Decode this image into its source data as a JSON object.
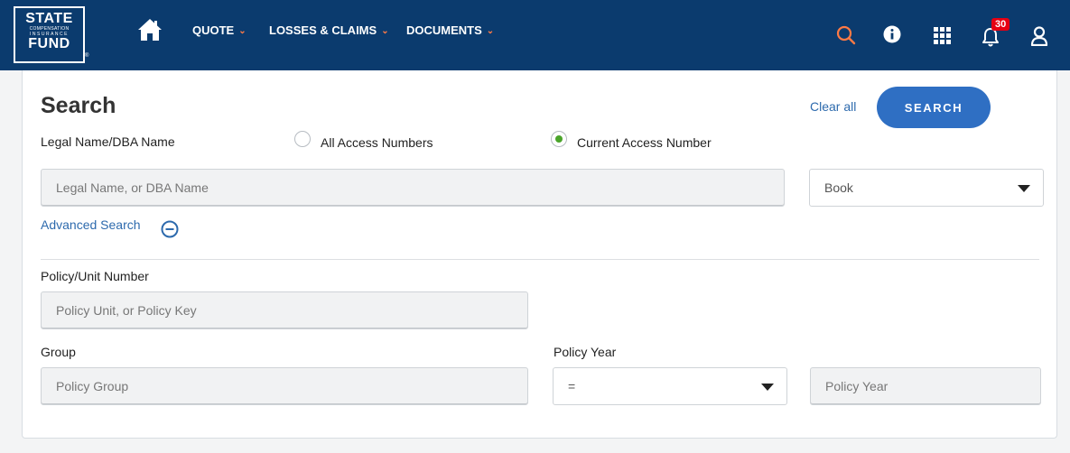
{
  "brand": {
    "line1": "STATE",
    "line2": "COMPENSATION",
    "line3": "INSURANCE",
    "line4": "FUND",
    "registered": "®"
  },
  "nav": {
    "items": [
      {
        "label": "QUOTE",
        "chevron": "⌄"
      },
      {
        "label": "LOSSES & CLAIMS",
        "chevron": "⌄"
      },
      {
        "label": "DOCUMENTS",
        "chevron": "⌄"
      }
    ],
    "icons": [
      "home-icon",
      "search-icon",
      "info-icon",
      "apps-grid-icon",
      "bell-icon",
      "user-icon"
    ],
    "notification_count": "30",
    "colors": {
      "bar": "#0b3b6e",
      "accent": "#ff7a45",
      "badge": "#e60012"
    }
  },
  "search": {
    "title": "Search",
    "clear_all": "Clear all",
    "search_button": "SEARCH",
    "scope_label": "Legal Name/DBA Name",
    "radio_all": "All Access Numbers",
    "radio_current": "Current Access Number",
    "selected_scope": "Current Access Number",
    "name_placeholder": "Legal Name, or DBA Name",
    "book_select": "Book",
    "advanced_link": "Advanced Search"
  },
  "advanced": {
    "policy_label": "Policy/Unit Number",
    "policy_placeholder": "Policy Unit, or Policy Key",
    "group_label": "Group",
    "group_placeholder": "Policy Group",
    "year_label": "Policy Year",
    "year_operator": "=",
    "year_placeholder": "Policy Year"
  },
  "colors": {
    "primary_button": "#2f6fc3",
    "link": "#2d6aad",
    "radio_selected": "#4aa42a"
  }
}
